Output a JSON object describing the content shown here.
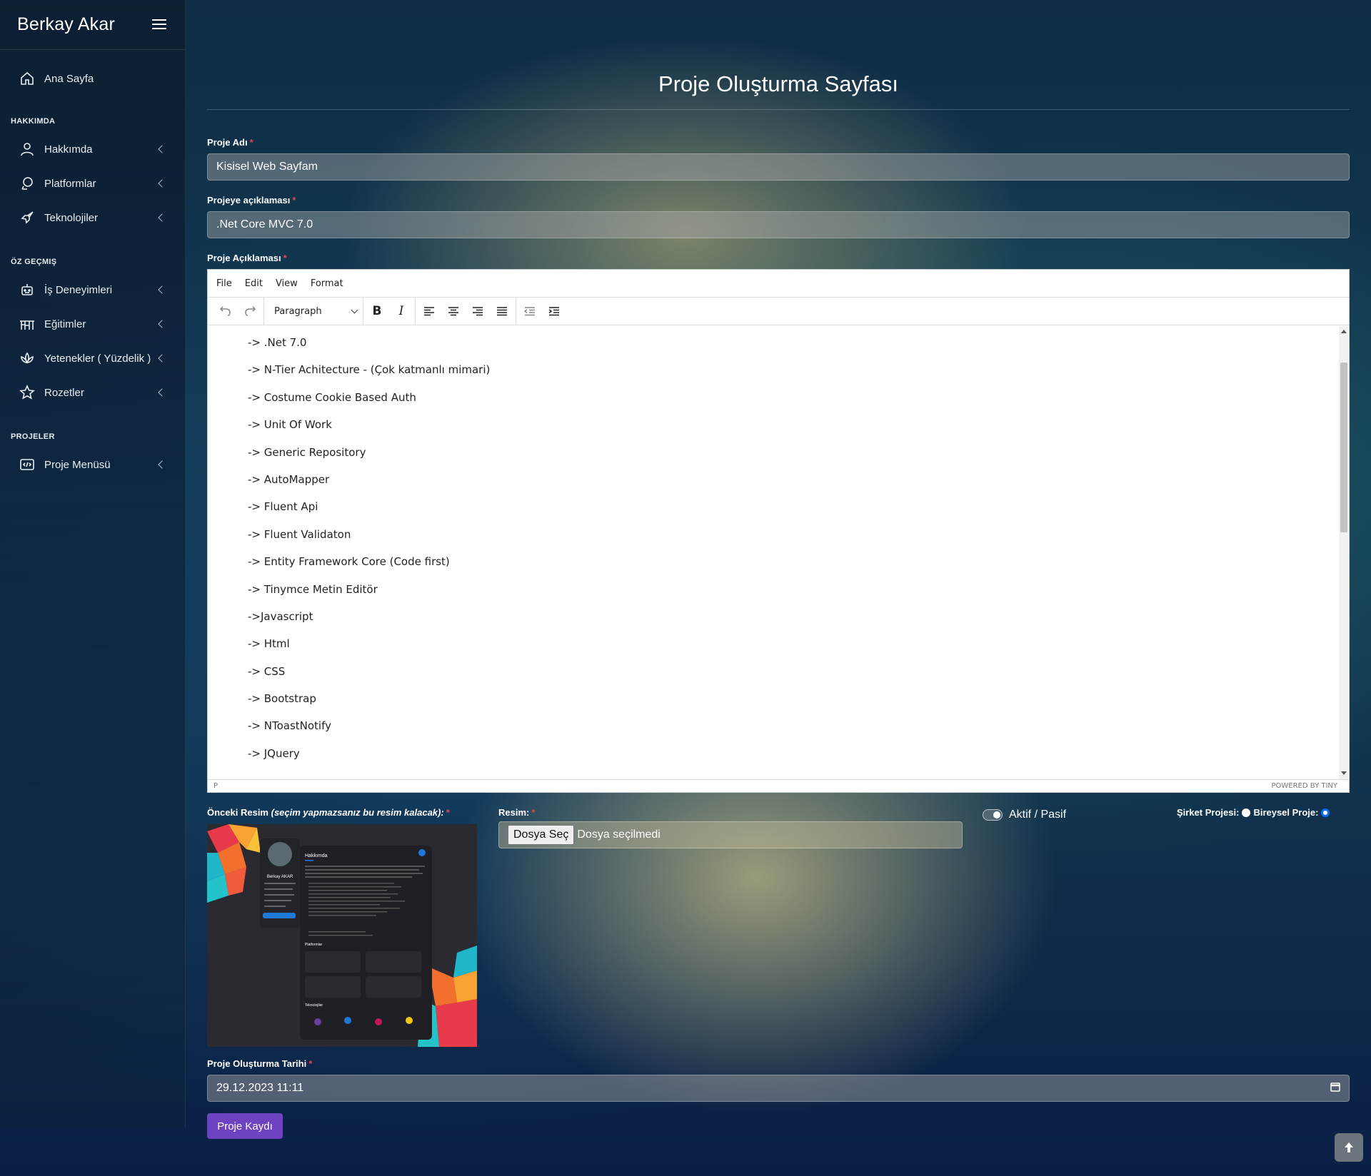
{
  "brand": "Berkay Akar",
  "nav": {
    "home": "Ana Sayfa",
    "sections": [
      {
        "header": "HAKKIMDA",
        "items": [
          "Hakkımda",
          "Platformlar",
          "Teknolojiler"
        ]
      },
      {
        "header": "ÖZ GEÇMIŞ",
        "items": [
          "İş Deneyimleri",
          "Eğitimler",
          "Yetenekler ( Yüzdelik )",
          "Rozetler"
        ]
      },
      {
        "header": "PROJELER",
        "items": [
          "Proje Menüsü"
        ]
      }
    ]
  },
  "page_title": "Proje Oluşturma Sayfası",
  "form": {
    "name_label": "Proje Adı",
    "name_value": "Kisisel Web Sayfam",
    "desc_label": "Projeye açıklaması",
    "desc_value": ".Net Core MVC 7.0",
    "content_label": "Proje Açıklaması",
    "editor": {
      "menu": [
        "File",
        "Edit",
        "View",
        "Format"
      ],
      "block_format": "Paragraph",
      "lines": [
        "-> .Net 7.0",
        "-> N-Tier Achitecture - (Çok katmanlı mimari)",
        "-> Costume Cookie Based Auth",
        "-> Unit Of Work",
        "-> Generic Repository",
        "-> AutoMapper",
        "-> Fluent Api",
        "-> Fluent Validaton",
        "-> Entity Framework Core (Code first)",
        "-> Tinymce Metin Editör",
        "->Javascript",
        "-> Html",
        "-> CSS",
        "-> Bootstrap",
        "-> NToastNotify",
        "-> JQuery"
      ],
      "status_path": "P",
      "powered_by": "POWERED BY TINY"
    },
    "prev_image_label": "Önceki Resim",
    "prev_image_note": "(seçim yapmazsanız bu resim kalacak):",
    "image_label": "Resim:",
    "file_button": "Dosya Seç",
    "file_status": "Dosya seçilmedi",
    "active_label": "Aktif / Pasif",
    "company_label": "Şirket Projesi:",
    "individual_label": "Bireysel Proje:",
    "date_label": "Proje Oluşturma Tarihi",
    "date_value": "29.12.2023 11:11",
    "submit_label": "Proje Kaydı"
  },
  "preview": {
    "name": "Berkay AKAR",
    "section_about": "Hakkımda",
    "section_platforms": "Platformlar",
    "section_tech": "Teknolojiler"
  },
  "colors": {
    "accent": "#6f42c1",
    "required": "#e04a4a",
    "radio": "#0d6efd"
  }
}
